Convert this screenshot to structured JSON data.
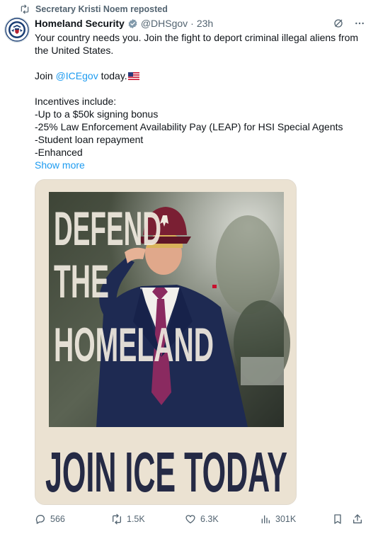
{
  "repost": {
    "label": "Secretary Kristi Noem reposted"
  },
  "author": {
    "name": "Homeland Security",
    "handle": "@DHSgov",
    "separator": "·",
    "time": "23h"
  },
  "tweet": {
    "line1": "Your country needs you. Join the fight to deport criminal illegal aliens from the United States.",
    "join_prefix": "Join ",
    "mention": "@ICEgov",
    "join_suffix": " today.",
    "incentives_heading": "Incentives include:",
    "incentives": [
      "-Up to a $50k signing bonus",
      "-25% Law Enforcement Availability Pay (LEAP) for HSI Special Agents",
      "-Student loan repayment",
      "-Enhanced"
    ],
    "show_more": "Show more"
  },
  "media": {
    "headline_lines": [
      "DEFEND",
      "THE",
      "HOMELAND"
    ],
    "bottom_text": "JOIN ICE TODAY"
  },
  "actions": {
    "replies": "566",
    "reposts": "1.5K",
    "likes": "6.3K",
    "views": "301K"
  },
  "colors": {
    "link": "#1d9bf0",
    "secondary_text": "#536471",
    "poster_background": "#ebe2d2",
    "poster_text": "#252a45",
    "headline_text": "#f1ebe0"
  }
}
